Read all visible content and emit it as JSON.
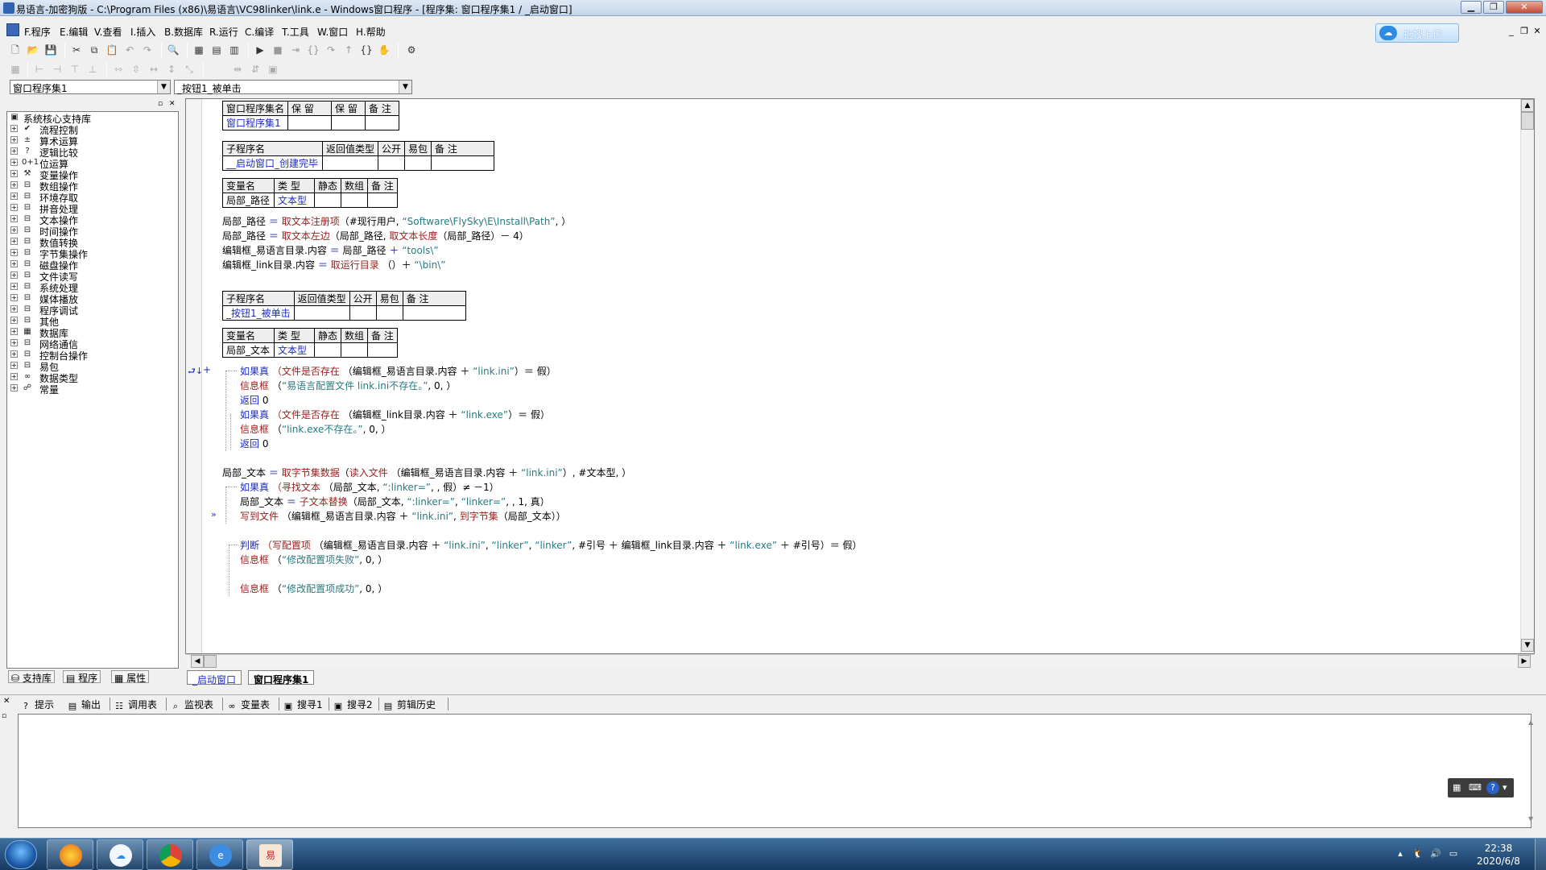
{
  "window": {
    "title": "易语言-加密狗版 - C:\\Program Files (x86)\\易语言\\VC98linker\\link.e - Windows窗口程序 - [程序集: 窗口程序集1 / _启动窗口]"
  },
  "menu": [
    "F.程序",
    "E.编辑",
    "V.查看",
    "I.插入",
    "B.数据库",
    "R.运行",
    "C.编译",
    "T.工具",
    "W.窗口",
    "H.帮助"
  ],
  "upload": {
    "label": "拖拽上传",
    "icon": "cloud-icon"
  },
  "combos": {
    "left": "窗口程序集1",
    "right": "_按钮1_被单击"
  },
  "tree": [
    "系统核心支持库",
    "流程控制",
    "算术运算",
    "逻辑比较",
    "位运算",
    "变量操作",
    "数组操作",
    "环境存取",
    "拼音处理",
    "文本操作",
    "时间操作",
    "数值转换",
    "字节集操作",
    "磁盘操作",
    "文件读写",
    "系统处理",
    "媒体播放",
    "程序调试",
    "其他",
    "数据库",
    "网络通信",
    "控制台操作",
    "易包",
    "数据类型",
    "常量"
  ],
  "left_tabs": [
    "支持库",
    "程序",
    "属性"
  ],
  "tables": {
    "assembly": {
      "headers": [
        "窗口程序集名",
        "保 留",
        "保 留",
        "备 注"
      ],
      "row": [
        "窗口程序集1",
        "",
        "",
        ""
      ]
    },
    "sub1": {
      "headers": [
        "子程序名",
        "返回值类型",
        "公开",
        "易包",
        "备 注"
      ],
      "row": [
        "__启动窗口_创建完毕",
        "",
        "",
        "",
        ""
      ]
    },
    "vars1": {
      "headers": [
        "变量名",
        "类 型",
        "静态",
        "数组",
        "备 注"
      ],
      "row": [
        "局部_路径",
        "文本型",
        "",
        "",
        ""
      ]
    },
    "sub2": {
      "headers": [
        "子程序名",
        "返回值类型",
        "公开",
        "易包",
        "备 注"
      ],
      "row": [
        "_按钮1_被单击",
        "",
        "",
        "",
        ""
      ]
    },
    "vars2": {
      "headers": [
        "变量名",
        "类 型",
        "静态",
        "数组",
        "备 注"
      ],
      "row": [
        "局部_文本",
        "文本型",
        "",
        "",
        ""
      ]
    }
  },
  "code": {
    "l1": {
      "a": "局部_路径",
      "b": "＝",
      "c": "取文本注册项",
      "d": "（#现行用户, ",
      "e": "“Software\\FlySky\\E\\Install\\Path”",
      "f": ", ）"
    },
    "l2": {
      "a": "局部_路径",
      "b": "＝",
      "c": "取文本左边",
      "d": "（局部_路径, ",
      "e": "取文本长度",
      "f": "（局部_路径）－ 4）"
    },
    "l3": {
      "a": "编辑框_易语言目录.内容",
      "b": "＝",
      "c": "局部_路径",
      "d": "＋",
      "e": "“tools\\”"
    },
    "l4": {
      "a": "编辑框_link目录.内容",
      "b": "＝",
      "c": "取运行目录",
      "d": "（）＋",
      "e": "“\\bin\\”"
    },
    "l5": {
      "a": "如果真",
      "b": "（",
      "c": "文件是否存在",
      "d": "（编辑框_易语言目录.内容 ＋ ",
      "e": "“link.ini”",
      "f": "）＝ 假）"
    },
    "l6": {
      "a": "信息框",
      "b": "（",
      "c": "“易语言配置文件 link.ini不存在。”",
      "d": ", 0, ）"
    },
    "l7": {
      "a": "返回",
      "b": "0"
    },
    "l8": {
      "a": "如果真",
      "b": "（",
      "c": "文件是否存在",
      "d": "（编辑框_link目录.内容 ＋ ",
      "e": "“link.exe”",
      "f": "）＝ 假）"
    },
    "l9": {
      "a": "信息框",
      "b": "（",
      "c": "“link.exe不存在。”",
      "d": ", 0, ）"
    },
    "l10": {
      "a": "返回",
      "b": "0"
    },
    "l11": {
      "a": "局部_文本",
      "b": "＝",
      "c": "取字节集数据",
      "d": "（",
      "e": "读入文件",
      "f": "（编辑框_易语言目录.内容 ＋ ",
      "g": "“link.ini”",
      "h": "）, #文本型, ）"
    },
    "l12": {
      "a": "如果真",
      "b": "（",
      "c": "寻找文本",
      "d": "（局部_文本, ",
      "e": "“:linker=”",
      "f": ", , 假）≠ －1）"
    },
    "l13": {
      "a": "局部_文本",
      "b": "＝",
      "c": "子文本替换",
      "d": "（局部_文本, ",
      "e": "“:linker=”",
      "f": ", ",
      "g": "“linker=”",
      "h": ", , 1, 真）"
    },
    "l14": {
      "a": "写到文件",
      "b": "（编辑框_易语言目录.内容 ＋ ",
      "c": "“link.ini”",
      "d": ", ",
      "e": "到字节集",
      "f": "（局部_文本））"
    },
    "l15": {
      "a": "判断",
      "b": "（",
      "c": "写配置项",
      "d": "（编辑框_易语言目录.内容 ＋ ",
      "e": "“link.ini”",
      "f": ", ",
      "g": "“linker”",
      "h": ", ",
      "i": "“linker”",
      "j": ", #引号 ＋ 编辑框_link目录.内容 ＋ ",
      "k": "“link.exe”",
      "l": " ＋ #引号）＝ 假）"
    },
    "l16": {
      "a": "信息框",
      "b": "（",
      "c": "“修改配置项失败”",
      "d": ", 0, ）"
    },
    "l17": {
      "a": "信息框",
      "b": "（",
      "c": "“修改配置项成功”",
      "d": ", 0, ）"
    }
  },
  "editor_tabs": [
    "_启动窗口",
    "窗口程序集1"
  ],
  "bottom_tabs": [
    "提示",
    "输出",
    "调用表",
    "监视表",
    "变量表",
    "搜寻1",
    "搜寻2",
    "剪辑历史"
  ],
  "taskbar": {
    "time": "22:38",
    "date": "2020/6/8"
  },
  "colors": {
    "title_bar": "#c4d5ea",
    "taskbar": "#1f4a78",
    "code_keyword": "#1b2bc7",
    "code_function": "#9b1c1c",
    "code_string": "#287b81"
  }
}
